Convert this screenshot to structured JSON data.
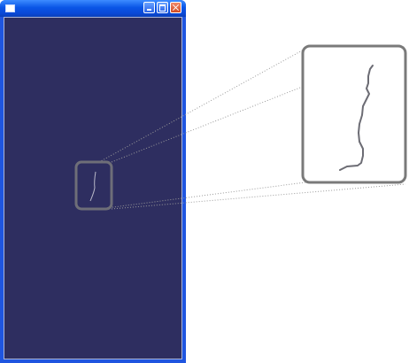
{
  "window": {
    "title": "",
    "controls": {
      "minimize_icon": "minimize-icon",
      "maximize_icon": "maximize-icon",
      "close_icon": "close-icon"
    }
  },
  "colors": {
    "canvas_background": "#2e2e60",
    "stroke": "#8c8ca0",
    "magnifier_frame": "#7a7a7a",
    "title_bar": "#0a55e6"
  }
}
